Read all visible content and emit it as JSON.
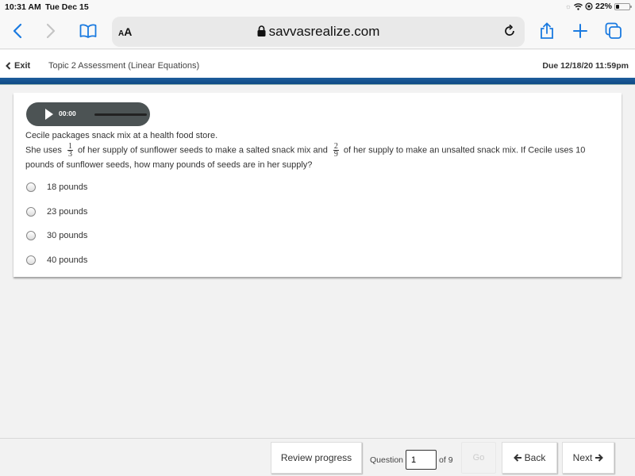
{
  "status_bar": {
    "time": "10:31 AM",
    "date": "Tue Dec 15",
    "battery_percent": "22%",
    "battery_level": 0.22
  },
  "browser": {
    "text_size_label": "AA",
    "url": "savvasrealize.com",
    "icons": [
      "back-icon",
      "forward-icon",
      "bookmarks-icon",
      "lock-icon",
      "reload-icon",
      "share-icon",
      "new-tab-icon",
      "tabs-icon"
    ]
  },
  "header": {
    "exit_label": "Exit",
    "assessment_title": "Topic 2 Assessment (Linear Equations)",
    "due": "Due 12/18/20 11:59pm"
  },
  "audio": {
    "time": "00:00"
  },
  "question": {
    "line1": "Cecile packages snack mix at a health food store.",
    "part1": "She uses",
    "frac1": {
      "num": "1",
      "den": "3"
    },
    "part2": "of her supply of sunflower seeds to make a salted snack mix and",
    "frac2": {
      "num": "2",
      "den": "9"
    },
    "part3": "of her supply to make an unsalted snack mix. If Cecile uses 10 pounds of sunflower seeds, how many pounds of seeds are in her supply?"
  },
  "options": [
    {
      "label": "18 pounds",
      "selected": false
    },
    {
      "label": "23 pounds",
      "selected": false
    },
    {
      "label": "30 pounds",
      "selected": false
    },
    {
      "label": "40 pounds",
      "selected": false
    }
  ],
  "footer": {
    "review_label": "Review progress",
    "question_label": "Question",
    "question_value": "1",
    "of_label": "of 9",
    "go_label": "Go",
    "back_label": "Back",
    "next_label": "Next"
  }
}
